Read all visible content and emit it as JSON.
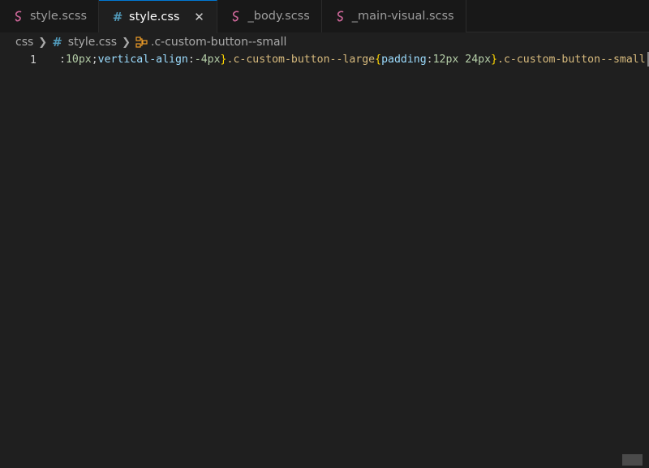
{
  "tabs": [
    {
      "label": "style.scss",
      "icon": "sass-icon",
      "active": false
    },
    {
      "label": "style.css",
      "icon": "css-hash-icon",
      "active": true,
      "close": "✕"
    },
    {
      "label": "_body.scss",
      "icon": "sass-icon",
      "active": false
    },
    {
      "label": "_main-visual.scss",
      "icon": "sass-icon",
      "active": false
    }
  ],
  "breadcrumb": {
    "folder": "css",
    "file": "style.css",
    "symbol": ".c-custom-button--small"
  },
  "editor": {
    "line_number": "1",
    "tokens": {
      "t0": ":",
      "t1": "10px",
      "t2": ";",
      "t3": "vertical-align",
      "t4": ":",
      "t5": "-4px",
      "t6": "}",
      "t7": ".c-custom-button--large",
      "t8": "{",
      "t9": "padding",
      "t10": ":",
      "t11": "12px 24px",
      "t12": "}",
      "t13": ".c-custom-button--small"
    }
  },
  "colors": {
    "accent": "#0078d4",
    "sass": "#cd6799",
    "css": "#519aba",
    "symbol": "#ee9d28"
  }
}
